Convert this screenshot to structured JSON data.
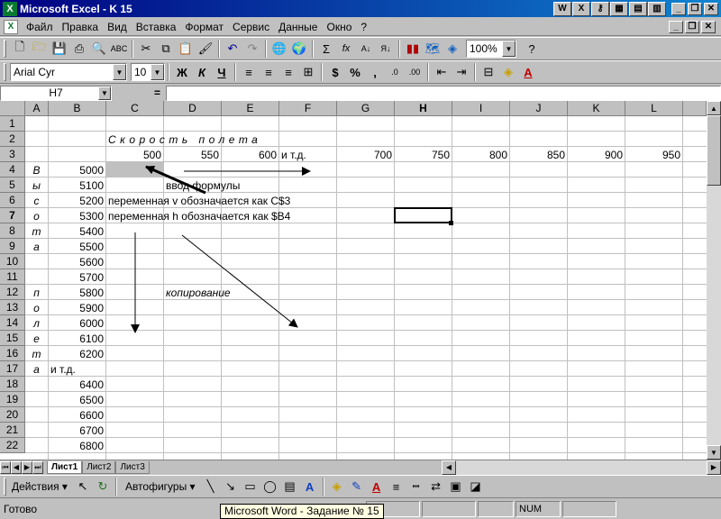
{
  "window": {
    "title": "Microsoft Excel - K 15"
  },
  "menu": [
    "Файл",
    "Правка",
    "Вид",
    "Вставка",
    "Формат",
    "Сервис",
    "Данные",
    "Окно",
    "?"
  ],
  "toolbar": {
    "zoom": "100%"
  },
  "format": {
    "font": "Arial Cyr",
    "size": "10",
    "bold": "Ж",
    "italic": "К",
    "underline": "Ч",
    "currency": "$",
    "percent": "%",
    "comma": ","
  },
  "formula": {
    "cell": "H7",
    "eq": "=",
    "value": ""
  },
  "columns": [
    "A",
    "B",
    "C",
    "D",
    "E",
    "F",
    "G",
    "H",
    "I",
    "J",
    "K",
    "L"
  ],
  "rows": [
    "1",
    "2",
    "3",
    "4",
    "5",
    "6",
    "7",
    "8",
    "9",
    "10",
    "11",
    "12",
    "13",
    "14",
    "15",
    "16",
    "17",
    "18",
    "19",
    "20",
    "21",
    "22"
  ],
  "sheet": {
    "title_text": "Скорость полета",
    "row3": [
      "500",
      "550",
      "600",
      "и т.д.",
      "700",
      "750",
      "800",
      "850",
      "900",
      "950"
    ],
    "vertical_letters": [
      "В",
      "ы",
      "с",
      "о",
      "т",
      "а",
      "",
      "",
      "п",
      "о",
      "л",
      "е",
      "т",
      "а"
    ],
    "colB": [
      "5000",
      "5100",
      "5200",
      "5300",
      "5400",
      "5500",
      "5600",
      "5700",
      "5800",
      "5900",
      "6000",
      "6100",
      "6200",
      "и т.д.",
      "6400",
      "6500",
      "6600",
      "6700",
      "6800"
    ],
    "note_formula": "ввод формулы",
    "note_v": "переменная v обозначается как С$3",
    "note_h": "переменная h обозначается как $B4",
    "note_copy": "копирование"
  },
  "sheets": [
    "Лист1",
    "Лист2",
    "Лист3"
  ],
  "draw": {
    "actions": "Действия",
    "autoshapes": "Автофигуры"
  },
  "status": {
    "ready": "Готово",
    "num": "NUM"
  },
  "taskbar_tip": "Microsoft Word - Задание № 15"
}
